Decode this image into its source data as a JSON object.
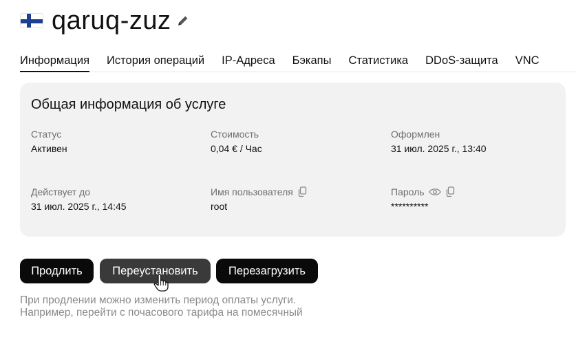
{
  "service": {
    "name": "qaruq-zuz",
    "flag_icon": "finland-flag-icon",
    "edit_icon": "pencil-icon"
  },
  "tabs": [
    {
      "label": "Информация",
      "active": true
    },
    {
      "label": "История операций"
    },
    {
      "label": "IP-Адреса"
    },
    {
      "label": "Бэкапы"
    },
    {
      "label": "Статистика"
    },
    {
      "label": "DDoS-защита"
    },
    {
      "label": "VNC"
    }
  ],
  "info_card": {
    "title": "Общая информация об услуге",
    "status": {
      "label": "Статус",
      "value": "Активен"
    },
    "cost": {
      "label": "Стоимость",
      "value": "0,04 € / Час"
    },
    "issued": {
      "label": "Оформлен",
      "value": "31 июл. 2025 г., 13:40"
    },
    "valid_until": {
      "label": "Действует до",
      "value": "31 июл. 2025 г., 14:45"
    },
    "username": {
      "label": "Имя пользователя",
      "value": "root",
      "icon": "copy-icon"
    },
    "password": {
      "label": "Пароль",
      "value": "**********",
      "icons": [
        "eye-icon",
        "copy-icon"
      ]
    }
  },
  "actions": {
    "renew_label": "Продлить",
    "reinstall_label": "Переустановить",
    "reboot_label": "Перезагрузить"
  },
  "hint": {
    "line1": "При продлении можно изменить период оплаты услуги.",
    "line2": "Например, перейти с почасового тарифа на помесячный"
  },
  "colors": {
    "card_background": "#f2f2f2",
    "button_background": "#0a0a0a",
    "button_hover": "#3a3a3a",
    "muted_text": "#8a8a8a"
  }
}
